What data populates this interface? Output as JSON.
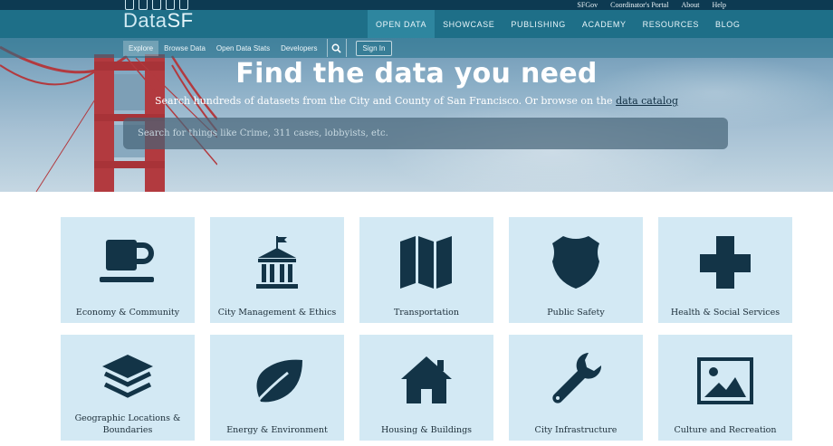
{
  "top_links": [
    "SFGov",
    "Coordinator's Portal",
    "About",
    "Help"
  ],
  "logo": {
    "prefix": "Data",
    "suffix": "SF"
  },
  "main_nav": [
    {
      "label": "OPEN DATA",
      "active": true
    },
    {
      "label": "SHOWCASE",
      "active": false
    },
    {
      "label": "PUBLISHING",
      "active": false
    },
    {
      "label": "ACADEMY",
      "active": false
    },
    {
      "label": "RESOURCES",
      "active": false
    },
    {
      "label": "BLOG",
      "active": false
    }
  ],
  "sub_nav": [
    {
      "label": "Explore",
      "active": true
    },
    {
      "label": "Browse Data",
      "active": false
    },
    {
      "label": "Open Data Stats",
      "active": false
    },
    {
      "label": "Developers",
      "active": false
    }
  ],
  "sign_in_label": "Sign In",
  "hero": {
    "title": "Find the data you need",
    "subtitle_prefix": "Search hundreds of datasets from the City and County of San Francisco. Or browse on the ",
    "subtitle_link": "data catalog",
    "search_placeholder": "Search for things like Crime, 311 cases, lobbyists, etc."
  },
  "categories": [
    {
      "label": "Economy & Community",
      "icon": "coffee-cup-icon"
    },
    {
      "label": "City Management & Ethics",
      "icon": "city-hall-icon"
    },
    {
      "label": "Transportation",
      "icon": "map-icon"
    },
    {
      "label": "Public Safety",
      "icon": "police-badge-icon"
    },
    {
      "label": "Health & Social Services",
      "icon": "medical-cross-icon"
    },
    {
      "label": "Geographic Locations & Boundaries",
      "icon": "layers-icon"
    },
    {
      "label": "Energy & Environment",
      "icon": "leaf-icon"
    },
    {
      "label": "Housing & Buildings",
      "icon": "house-icon"
    },
    {
      "label": "City Infrastructure",
      "icon": "wrench-icon"
    },
    {
      "label": "Culture and Recreation",
      "icon": "picture-icon"
    }
  ],
  "colors": {
    "nav_bg": "#1e6f88",
    "top_bg": "#0d3a52",
    "tile_bg": "#d3e9f4",
    "icon": "#133447",
    "bridge_red": "#b23a3f"
  }
}
